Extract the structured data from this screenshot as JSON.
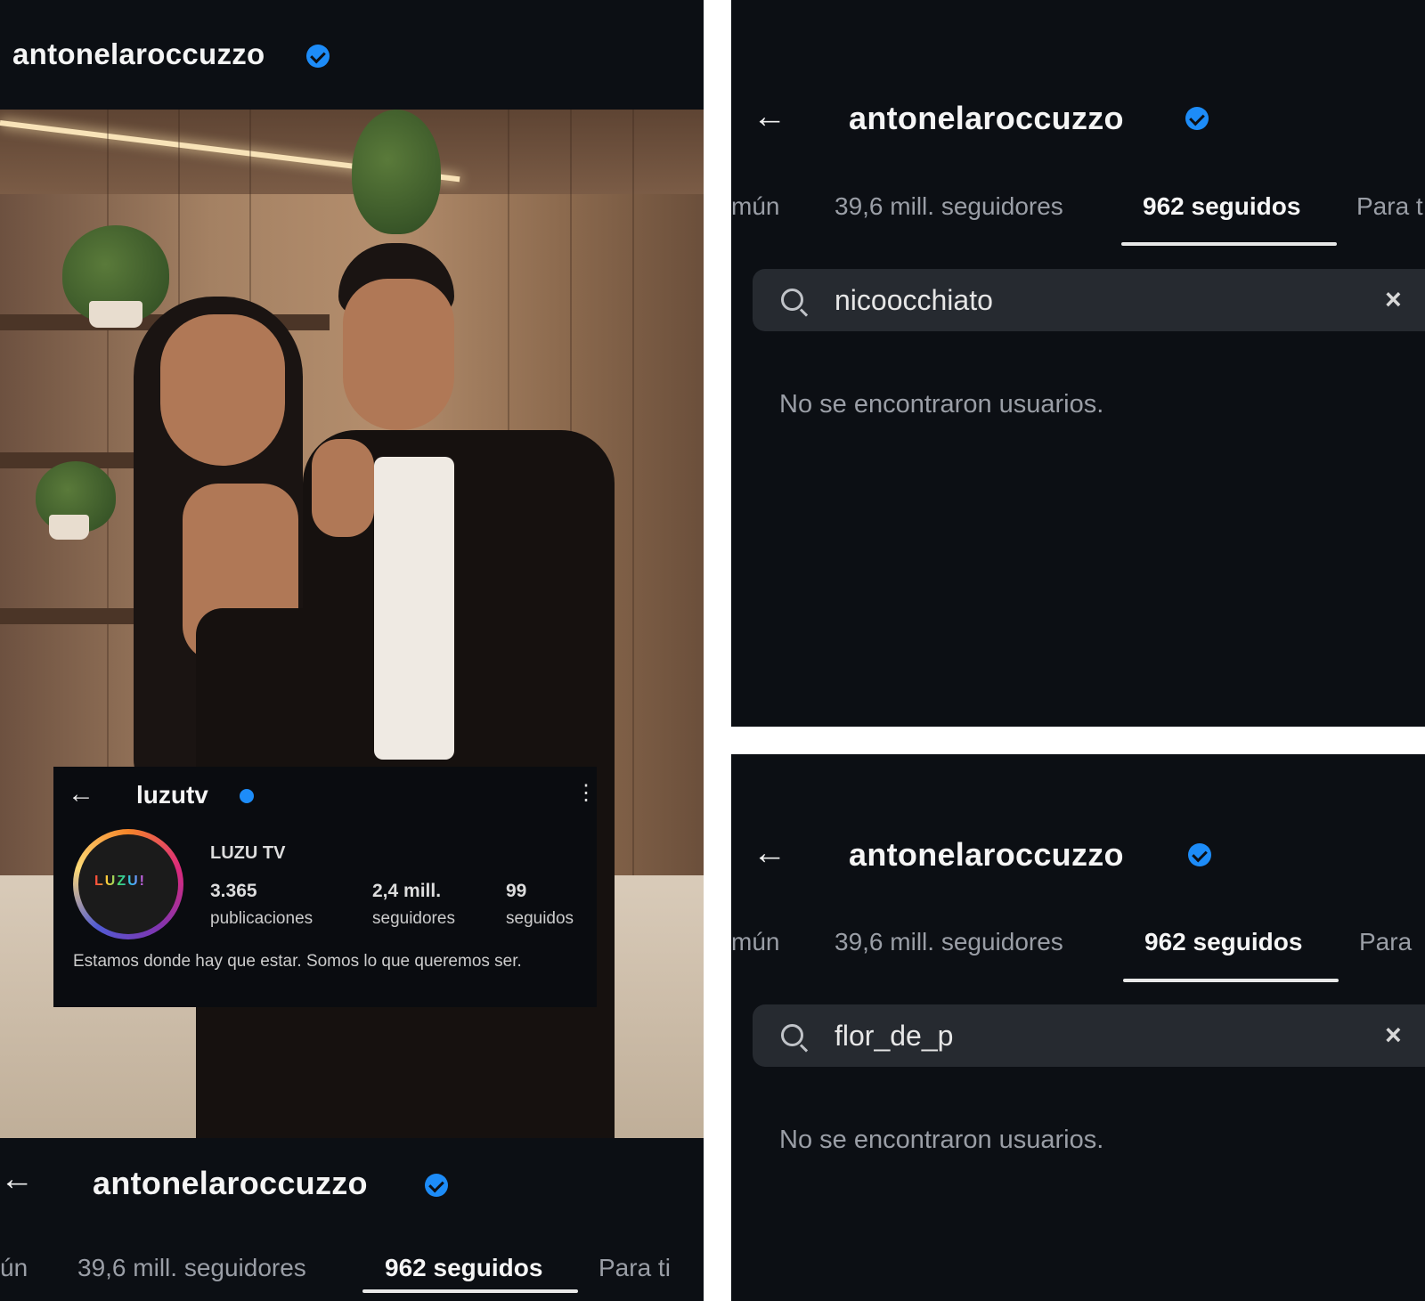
{
  "left_panel": {
    "header_username": "antonelaroccuzzo",
    "luzu_overlay": {
      "back_arrow": "←",
      "username": "luzutv",
      "more": "⋮",
      "avatar_logo": "LUZU!",
      "display_name": "LUZU TV",
      "stats": [
        {
          "number": "3.365",
          "label": "publicaciones"
        },
        {
          "number": "2,4 mill.",
          "label": "seguidores"
        },
        {
          "number": "99",
          "label": "seguidos"
        }
      ],
      "bio": "Estamos donde hay que estar. Somos lo que queremos ser."
    },
    "bottom_bar": {
      "back_arrow": "←",
      "username": "antonelaroccuzzo",
      "tabs": [
        "ún",
        "39,6 mill. seguidores",
        "962 seguidos",
        "Para ti"
      ],
      "active_tab": 2
    }
  },
  "right_top": {
    "back_arrow": "←",
    "username": "antonelaroccuzzo",
    "tabs": [
      "mún",
      "39,6 mill. seguidores",
      "962 seguidos",
      "Para t"
    ],
    "active_tab": 2,
    "search_value": "nicoocchiato",
    "clear": "×",
    "empty_message": "No se encontraron usuarios."
  },
  "right_bottom": {
    "back_arrow": "←",
    "username": "antonelaroccuzzo",
    "tabs": [
      "mún",
      "39,6 mill. seguidores",
      "962 seguidos",
      "Para"
    ],
    "active_tab": 2,
    "search_value": "flor_de_p",
    "clear": "×",
    "empty_message": "No se encontraron usuarios."
  },
  "colors": {
    "background": "#0c0f14",
    "verified": "#1d8cf8",
    "search_bg": "#262a30",
    "inactive_tab": "#9a9ea6"
  }
}
